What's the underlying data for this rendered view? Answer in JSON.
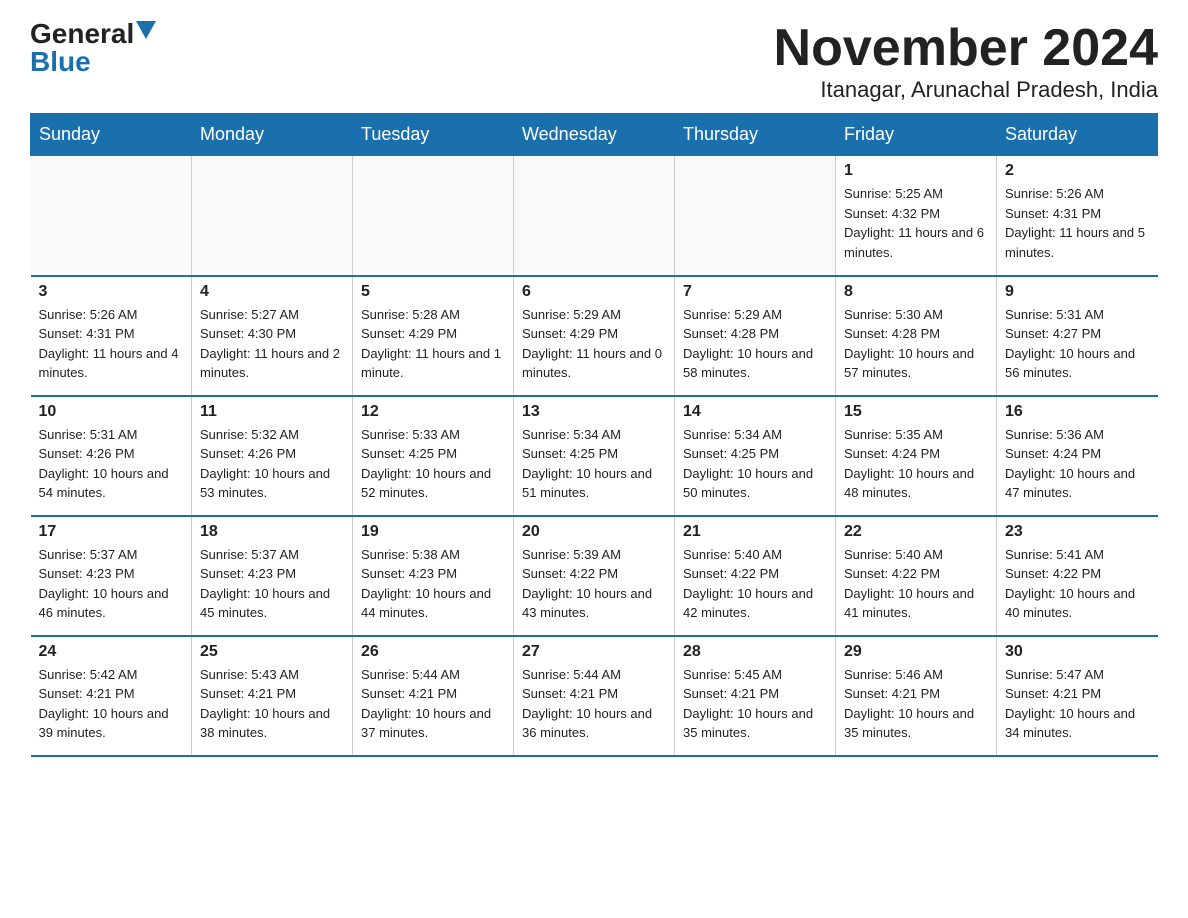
{
  "logo": {
    "general": "General",
    "blue": "Blue"
  },
  "title": "November 2024",
  "location": "Itanagar, Arunachal Pradesh, India",
  "weekdays": [
    "Sunday",
    "Monday",
    "Tuesday",
    "Wednesday",
    "Thursday",
    "Friday",
    "Saturday"
  ],
  "weeks": [
    [
      {
        "day": "",
        "info": ""
      },
      {
        "day": "",
        "info": ""
      },
      {
        "day": "",
        "info": ""
      },
      {
        "day": "",
        "info": ""
      },
      {
        "day": "",
        "info": ""
      },
      {
        "day": "1",
        "info": "Sunrise: 5:25 AM\nSunset: 4:32 PM\nDaylight: 11 hours and 6 minutes."
      },
      {
        "day": "2",
        "info": "Sunrise: 5:26 AM\nSunset: 4:31 PM\nDaylight: 11 hours and 5 minutes."
      }
    ],
    [
      {
        "day": "3",
        "info": "Sunrise: 5:26 AM\nSunset: 4:31 PM\nDaylight: 11 hours and 4 minutes."
      },
      {
        "day": "4",
        "info": "Sunrise: 5:27 AM\nSunset: 4:30 PM\nDaylight: 11 hours and 2 minutes."
      },
      {
        "day": "5",
        "info": "Sunrise: 5:28 AM\nSunset: 4:29 PM\nDaylight: 11 hours and 1 minute."
      },
      {
        "day": "6",
        "info": "Sunrise: 5:29 AM\nSunset: 4:29 PM\nDaylight: 11 hours and 0 minutes."
      },
      {
        "day": "7",
        "info": "Sunrise: 5:29 AM\nSunset: 4:28 PM\nDaylight: 10 hours and 58 minutes."
      },
      {
        "day": "8",
        "info": "Sunrise: 5:30 AM\nSunset: 4:28 PM\nDaylight: 10 hours and 57 minutes."
      },
      {
        "day": "9",
        "info": "Sunrise: 5:31 AM\nSunset: 4:27 PM\nDaylight: 10 hours and 56 minutes."
      }
    ],
    [
      {
        "day": "10",
        "info": "Sunrise: 5:31 AM\nSunset: 4:26 PM\nDaylight: 10 hours and 54 minutes."
      },
      {
        "day": "11",
        "info": "Sunrise: 5:32 AM\nSunset: 4:26 PM\nDaylight: 10 hours and 53 minutes."
      },
      {
        "day": "12",
        "info": "Sunrise: 5:33 AM\nSunset: 4:25 PM\nDaylight: 10 hours and 52 minutes."
      },
      {
        "day": "13",
        "info": "Sunrise: 5:34 AM\nSunset: 4:25 PM\nDaylight: 10 hours and 51 minutes."
      },
      {
        "day": "14",
        "info": "Sunrise: 5:34 AM\nSunset: 4:25 PM\nDaylight: 10 hours and 50 minutes."
      },
      {
        "day": "15",
        "info": "Sunrise: 5:35 AM\nSunset: 4:24 PM\nDaylight: 10 hours and 48 minutes."
      },
      {
        "day": "16",
        "info": "Sunrise: 5:36 AM\nSunset: 4:24 PM\nDaylight: 10 hours and 47 minutes."
      }
    ],
    [
      {
        "day": "17",
        "info": "Sunrise: 5:37 AM\nSunset: 4:23 PM\nDaylight: 10 hours and 46 minutes."
      },
      {
        "day": "18",
        "info": "Sunrise: 5:37 AM\nSunset: 4:23 PM\nDaylight: 10 hours and 45 minutes."
      },
      {
        "day": "19",
        "info": "Sunrise: 5:38 AM\nSunset: 4:23 PM\nDaylight: 10 hours and 44 minutes."
      },
      {
        "day": "20",
        "info": "Sunrise: 5:39 AM\nSunset: 4:22 PM\nDaylight: 10 hours and 43 minutes."
      },
      {
        "day": "21",
        "info": "Sunrise: 5:40 AM\nSunset: 4:22 PM\nDaylight: 10 hours and 42 minutes."
      },
      {
        "day": "22",
        "info": "Sunrise: 5:40 AM\nSunset: 4:22 PM\nDaylight: 10 hours and 41 minutes."
      },
      {
        "day": "23",
        "info": "Sunrise: 5:41 AM\nSunset: 4:22 PM\nDaylight: 10 hours and 40 minutes."
      }
    ],
    [
      {
        "day": "24",
        "info": "Sunrise: 5:42 AM\nSunset: 4:21 PM\nDaylight: 10 hours and 39 minutes."
      },
      {
        "day": "25",
        "info": "Sunrise: 5:43 AM\nSunset: 4:21 PM\nDaylight: 10 hours and 38 minutes."
      },
      {
        "day": "26",
        "info": "Sunrise: 5:44 AM\nSunset: 4:21 PM\nDaylight: 10 hours and 37 minutes."
      },
      {
        "day": "27",
        "info": "Sunrise: 5:44 AM\nSunset: 4:21 PM\nDaylight: 10 hours and 36 minutes."
      },
      {
        "day": "28",
        "info": "Sunrise: 5:45 AM\nSunset: 4:21 PM\nDaylight: 10 hours and 35 minutes."
      },
      {
        "day": "29",
        "info": "Sunrise: 5:46 AM\nSunset: 4:21 PM\nDaylight: 10 hours and 35 minutes."
      },
      {
        "day": "30",
        "info": "Sunrise: 5:47 AM\nSunset: 4:21 PM\nDaylight: 10 hours and 34 minutes."
      }
    ]
  ]
}
